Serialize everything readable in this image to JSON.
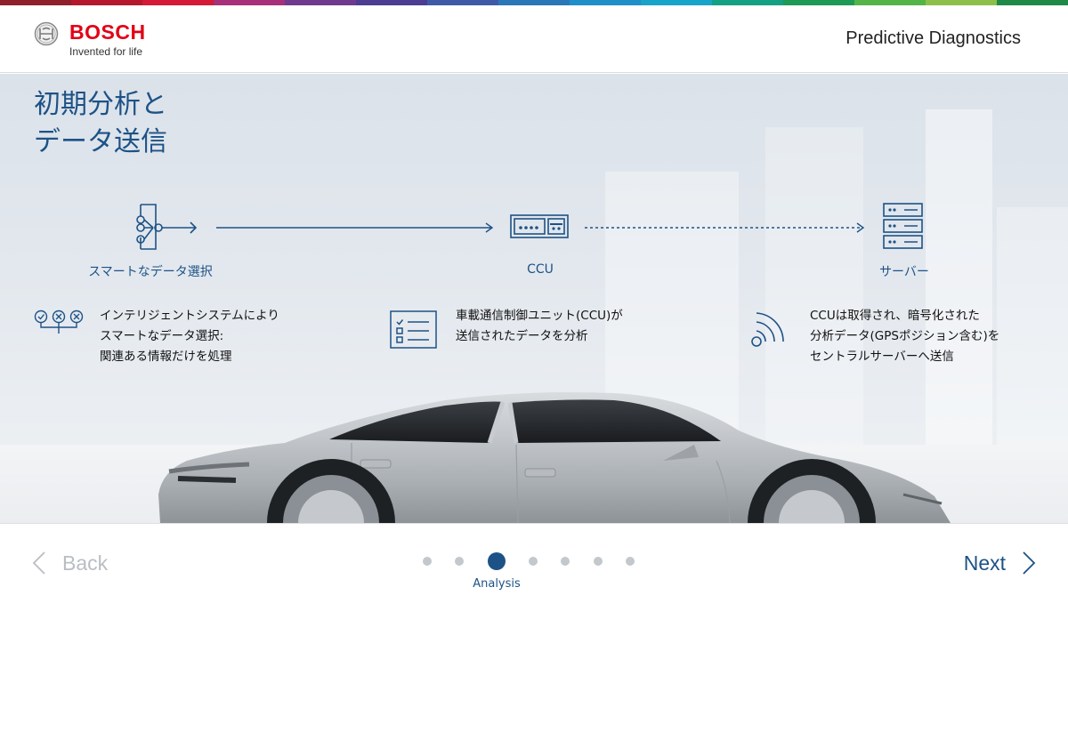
{
  "header": {
    "brand": "BOSCH",
    "tagline": "Invented for life",
    "app_title": "Predictive Diagnostics"
  },
  "colors": {
    "accent": "#1d5286",
    "brand_red": "#e20015",
    "inactive": "#c3c8cd",
    "strip": [
      "#8f1f2a",
      "#b5182d",
      "#d41a36",
      "#a6307a",
      "#6e3a8f",
      "#4c3c92",
      "#3e5aa6",
      "#2a77b8",
      "#1f8ec9",
      "#18a3c8",
      "#14a083",
      "#1e9a55",
      "#55b447",
      "#8cc04a",
      "#1f8a47"
    ]
  },
  "slide": {
    "title": "初期分析と\nデータ送信",
    "flow": [
      {
        "label": "スマートなデータ選択",
        "icon": "data-selection-icon"
      },
      {
        "label": "CCU",
        "icon": "ccu-device-icon"
      },
      {
        "label": "サーバー",
        "icon": "server-icon"
      }
    ],
    "descriptions": [
      {
        "icon": "check-cross-options-icon",
        "text": "インテリジェントシステムにより\nスマートなデータ選択:\n関連ある情報だけを処理"
      },
      {
        "icon": "checklist-icon",
        "text": "車載通信制御ユニット(CCU)が\n送信されたデータを分析"
      },
      {
        "icon": "wireless-signal-icon",
        "text": "CCUは取得され、暗号化された\n分析データ(GPSポジション含む)を\nセントラルサーバーへ送信"
      }
    ]
  },
  "footer": {
    "back_label": "Back",
    "next_label": "Next",
    "current_step_label": "Analysis",
    "steps_total": 7,
    "current_step": 3
  }
}
